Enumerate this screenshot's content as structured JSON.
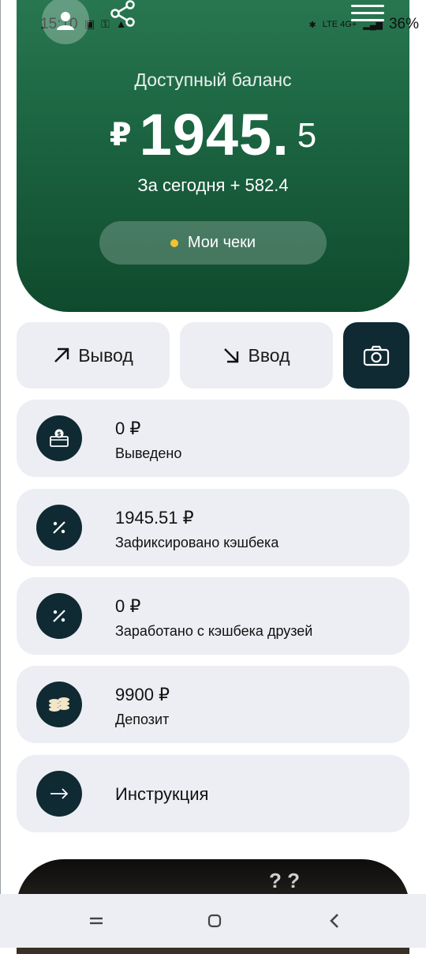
{
  "status_bar": {
    "time": "15:10",
    "battery": "36%",
    "network": "LTE 4G+"
  },
  "header": {
    "balance_label": "Доступный баланс",
    "currency_symbol": "₽",
    "balance_integer": "1945.",
    "balance_fraction": "5",
    "today_text": "За сегодня + 582.4",
    "receipts_label": "Мои чеки"
  },
  "actions": {
    "withdraw_label": "Вывод",
    "deposit_label": "Ввод"
  },
  "stats": [
    {
      "value": "0 ₽",
      "label": "Выведено",
      "icon": "wallet-dollar-icon"
    },
    {
      "value": "1945.51 ₽",
      "label": "Зафиксировано кэшбека",
      "icon": "percent-icon"
    },
    {
      "value": "0 ₽",
      "label": "Заработано с кэшбека друзей",
      "icon": "percent-icon"
    },
    {
      "value": "9900 ₽",
      "label": "Депозит",
      "icon": "coins-stack-icon"
    }
  ],
  "instructions_label": "Инструкция",
  "colors": {
    "hero_green": "#1c6542",
    "dark_navy": "#0f2a33",
    "card_bg": "#edeef3",
    "dot_yellow": "#f2c230"
  }
}
